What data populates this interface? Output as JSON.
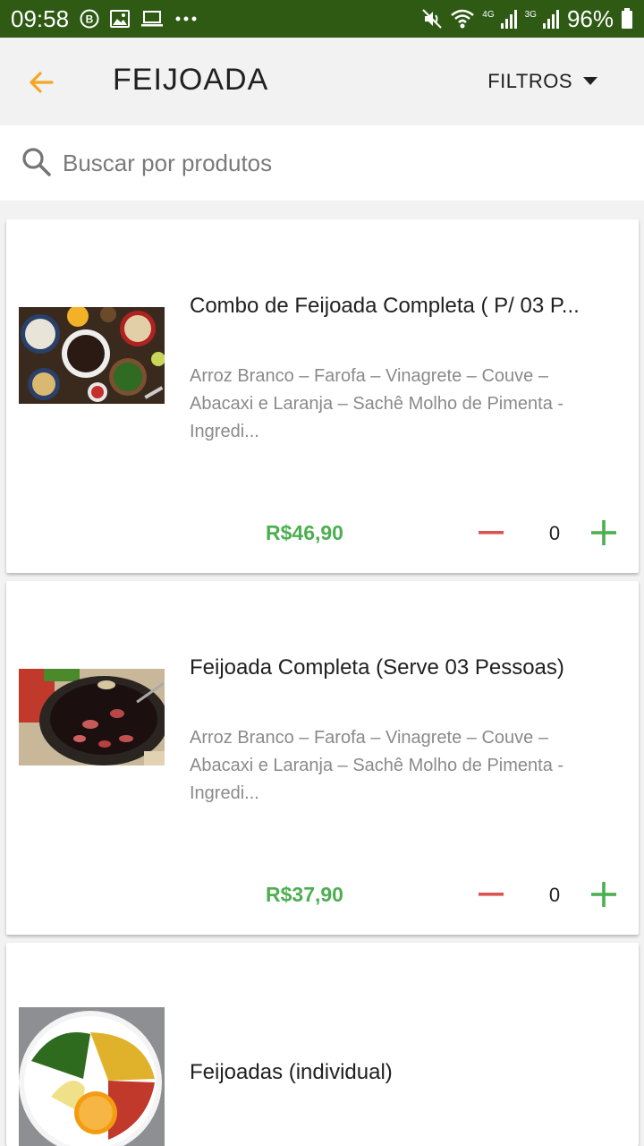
{
  "status_bar": {
    "time": "09:58",
    "left_icons": [
      "b-circle-icon",
      "image-icon",
      "laptop-icon",
      "more-icon"
    ],
    "network_4g": "4G",
    "network_3g": "3G",
    "battery": "96%"
  },
  "app_bar": {
    "title": "FEIJOADA",
    "filters_label": "FILTROS",
    "accent_color": "#f5a623"
  },
  "search": {
    "placeholder": "Buscar por produtos"
  },
  "products": [
    {
      "name": "Combo de Feijoada Completa ( P/ 03 P...",
      "description": "Arroz Branco – Farofa – Vinagrete – Couve – Abacaxi e Laranja – Sachê Molho de Pimenta - Ingredi...",
      "price": "R$46,90",
      "quantity": "0"
    },
    {
      "name": "Feijoada Completa (Serve 03 Pessoas)",
      "description": "Arroz Branco – Farofa – Vinagrete – Couve – Abacaxi e Laranja – Sachê Molho de Pimenta - Ingredi...",
      "price": "R$37,90",
      "quantity": "0"
    },
    {
      "name": "Feijoadas (individual)"
    }
  ],
  "colors": {
    "status_bar": "#2e5a14",
    "price": "#4caf50",
    "minus": "#d9534f",
    "plus": "#4caf50"
  }
}
